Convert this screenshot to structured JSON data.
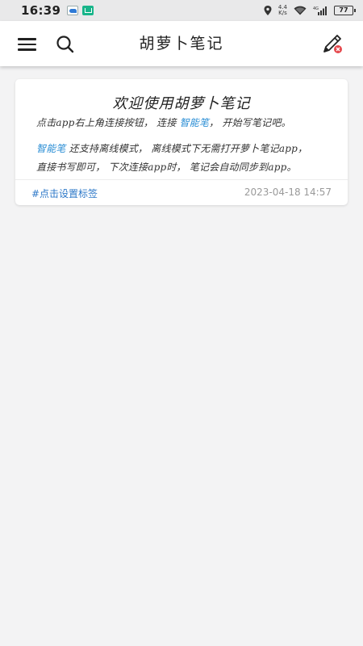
{
  "status_bar": {
    "time": "16:39",
    "net_speed_value": "4.4",
    "net_speed_unit": "K/s",
    "battery": "77"
  },
  "app_bar": {
    "title": "胡萝卜笔记",
    "menu_icon": "hamburger-menu-icon",
    "search_icon": "search-icon",
    "edit_icon": "pen-edit-icon"
  },
  "note": {
    "title": "欢迎使用胡萝卜笔记",
    "line1_a": "点击app右上角连接按钮，  连接 ",
    "line1_hl": "智能笔",
    "line1_b": "，  开始写笔记吧。",
    "line2_hl": "智能笔",
    "line2_b": " 还支持离线模式，  离线模式下无需打开萝卜笔记app，",
    "line3": "直接书写即可，  下次连接app时，  笔记会自动同步到app。",
    "tag_label": "#点击设置标签",
    "date": "2023-04-18 14:57",
    "highlight_color": "#2d8fd5"
  }
}
